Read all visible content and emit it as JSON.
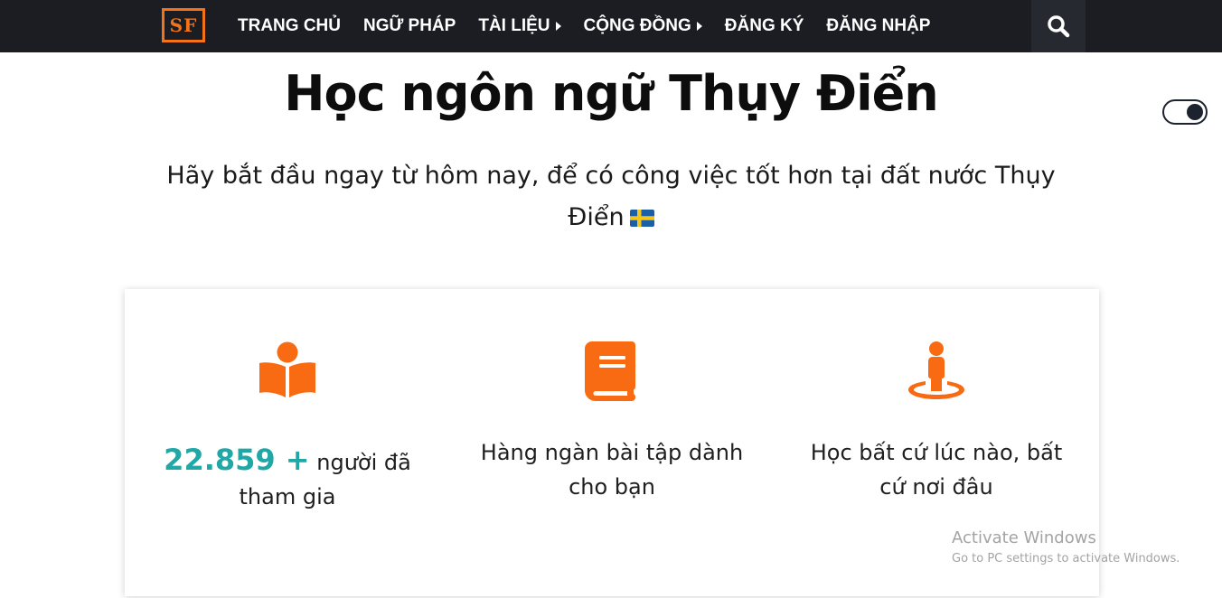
{
  "nav": {
    "logo_text": "SF",
    "items": [
      {
        "label": "TRANG CHỦ"
      },
      {
        "label": "NGỮ PHÁP"
      },
      {
        "label": "TÀI LIỆU"
      },
      {
        "label": "CỘNG ĐỒNG"
      },
      {
        "label": "ĐĂNG KÝ"
      },
      {
        "label": "ĐĂNG NHẬP"
      }
    ],
    "search_icon": "search-icon"
  },
  "hero": {
    "title": "Học ngôn ngữ Thụy Điển",
    "subtitle": "Hãy bắt đầu ngay từ hôm nay, để có công việc tốt hơn tại đất nước Thụy Điển",
    "flag_icon": "sweden-flag-icon"
  },
  "theme_toggle": {
    "state": "dark",
    "icon": "toggle-switch"
  },
  "features": [
    {
      "icon": "reader-icon",
      "stat": "22.859 +",
      "text": "người đã tham gia"
    },
    {
      "icon": "book-icon",
      "text": "Hàng ngàn bài tập dành cho bạn"
    },
    {
      "icon": "street-view-icon",
      "text": "Học bất cứ lúc nào, bất cứ nơi đâu"
    }
  ],
  "watermark": {
    "title": "Activate Windows",
    "subtitle": "Go to PC settings to activate Windows."
  },
  "colors": {
    "nav_bg": "#1b1d23",
    "brand_orange": "#f47318",
    "stat_teal": "#1fa8a6",
    "icon_orange": "#f86b12"
  }
}
